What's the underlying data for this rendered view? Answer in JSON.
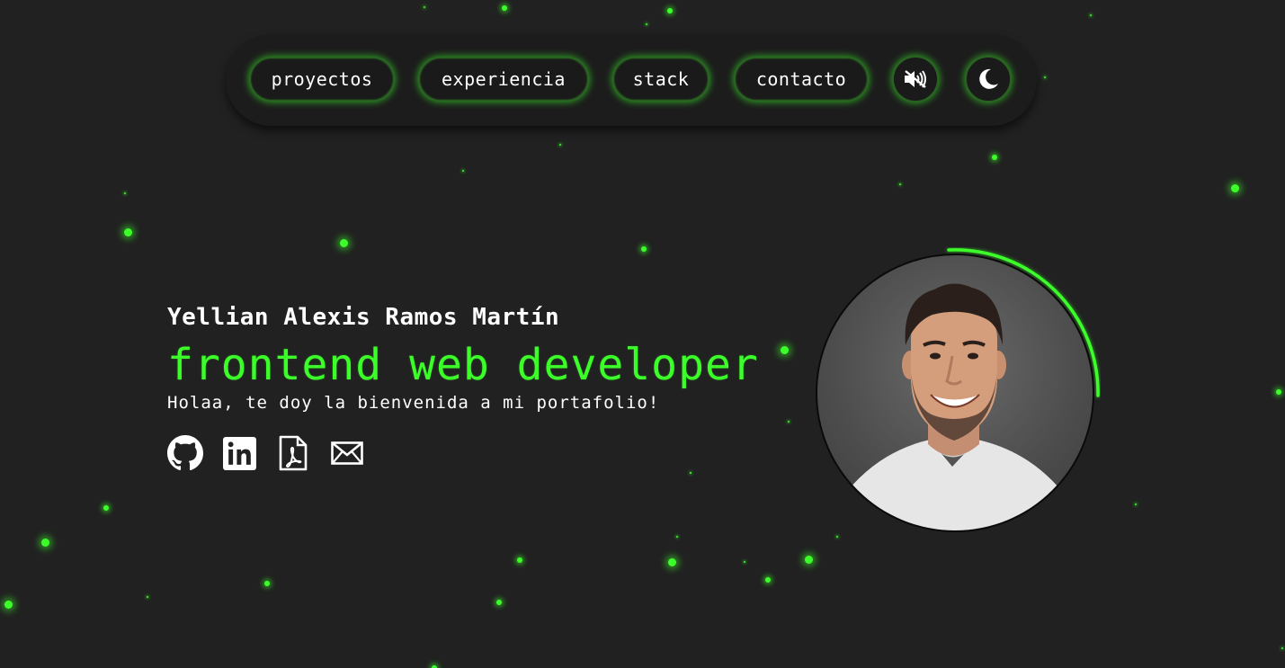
{
  "nav": {
    "items": [
      {
        "label": "proyectos"
      },
      {
        "label": "experiencia"
      },
      {
        "label": "stack"
      },
      {
        "label": "contacto"
      }
    ],
    "sound_icon": "speaker-muted-icon",
    "theme_icon": "moon-icon"
  },
  "hero": {
    "name": "Yellian Alexis Ramos Martín",
    "role": "frontend web developer",
    "welcome": "Holaa, te doy la bienvenida a mi portafolio!",
    "social": [
      {
        "icon": "github-icon"
      },
      {
        "icon": "linkedin-icon"
      },
      {
        "icon": "pdf-file-icon"
      },
      {
        "icon": "mail-icon"
      }
    ]
  },
  "avatar": {
    "icon": "profile-photo"
  },
  "colors": {
    "background": "#212121",
    "accent": "#3cff2a",
    "nav_bg": "#1c1c1c",
    "text": "#ffffff"
  }
}
